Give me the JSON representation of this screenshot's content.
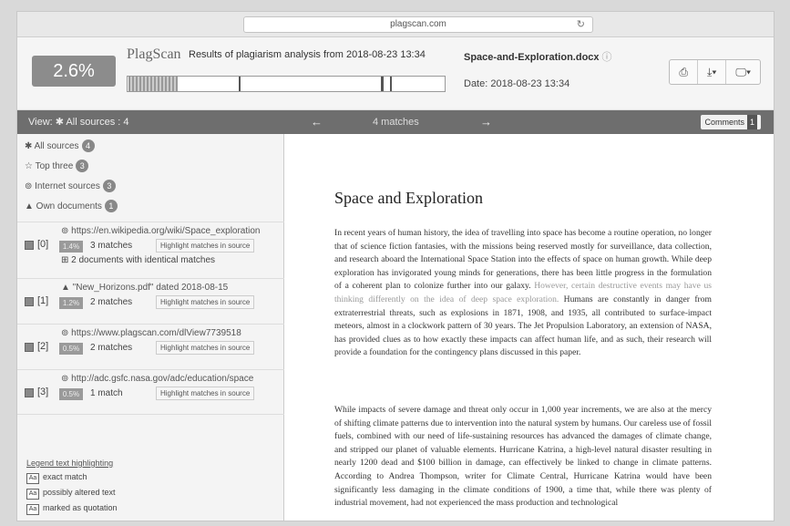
{
  "browser": {
    "url": "plagscan.com",
    "reload_icon": "reload-icon"
  },
  "header": {
    "score": "2.6%",
    "logo": "PlagScan",
    "analysis_title": "Results of plagiarism analysis from 2018-08-23 13:34",
    "filename": "Space-and-Exploration.docx",
    "date": "Date: 2018-08-23 13:34",
    "tools": {
      "print": "⎙",
      "download": "⤓▾",
      "display": "🖵▾"
    }
  },
  "toolbar": {
    "view": "View: ✱ All sources : 4",
    "prev": "←",
    "matches": "4 matches",
    "next": "→",
    "comments": "Comments",
    "comments_count": "1"
  },
  "sidebar": {
    "filters": [
      {
        "label": "✱ All sources",
        "count": "4"
      },
      {
        "label": "☆ Top three",
        "count": "3"
      },
      {
        "label": "⊚ Internet sources",
        "count": "3"
      },
      {
        "label": "▲ Own documents",
        "count": "1"
      }
    ],
    "sources": [
      {
        "index": "[0]",
        "url": "⊚ https://en.wikipedia.org/wiki/Space_exploration",
        "pct": "1.4%",
        "matches": "3 matches",
        "highlight": "Highlight matches in source",
        "identical": "⊞ 2 documents with identical matches"
      },
      {
        "index": "[1]",
        "url": "▲ \"New_Horizons.pdf\" dated 2018-08-15",
        "pct": "1.2%",
        "matches": "2 matches",
        "highlight": "Highlight matches in source"
      },
      {
        "index": "[2]",
        "url": "⊚ https://www.plagscan.com/dlView7739518",
        "pct": "0.5%",
        "matches": "2 matches",
        "highlight": "Highlight matches in source"
      },
      {
        "index": "[3]",
        "url": "⊚ http://adc.gsfc.nasa.gov/adc/education/space",
        "pct": "0.5%",
        "matches": "1 match",
        "highlight": "Highlight matches in source"
      }
    ],
    "legend": {
      "title": "Legend text highlighting",
      "items": [
        {
          "swatch": "Aa",
          "label": "exact match"
        },
        {
          "swatch": "Aa",
          "label": "possibly altered text"
        },
        {
          "swatch": "Aa",
          "label": "marked as quotation"
        }
      ]
    }
  },
  "document": {
    "title": "Space and Exploration",
    "p1_a": "In recent years of human history, the idea of travelling into space has become a routine operation, no longer that of science fiction fantasies, with the missions being reserved mostly for surveillance, data collection, and research aboard the International Space Station into the effects of space on human growth. While deep exploration has invigorated young minds for generations, there has been little progress in the formulation of a coherent plan to colonize further into our galaxy. ",
    "p1_faint": "However, certain destructive events may have us thinking differently on the idea of deep space exploration.",
    "p1_b": " Humans are constantly in danger from extraterrestrial threats, such as explosions in 1871, 1908, and 1935, all contributed to surface-impact meteors, almost in a clockwork pattern of 30 years. The Jet Propulsion Laboratory, an extension of NASA, has provided clues as to how exactly these impacts can affect human life, and as such, their research will provide a foundation for the contingency plans discussed in this paper.",
    "p2": "While impacts of severe damage and threat only occur in 1,000 year increments, we are also at the mercy of shifting climate patterns due to intervention into the natural system by humans. Our careless use of fossil fuels, combined with our need of life-sustaining resources has advanced the damages of climate change, and stripped our planet of valuable elements. Hurricane Katrina, a high-level natural disaster resulting in nearly 1200 dead and $100 billion in damage, can effectively be linked to change in climate patterns. According to Andrea Thompson, writer for Climate Central, Hurricane Katrina would have been significantly less damaging in the climate conditions of 1900, a time that, while there was plenty of industrial movement, had not experienced the mass production and technological"
  }
}
